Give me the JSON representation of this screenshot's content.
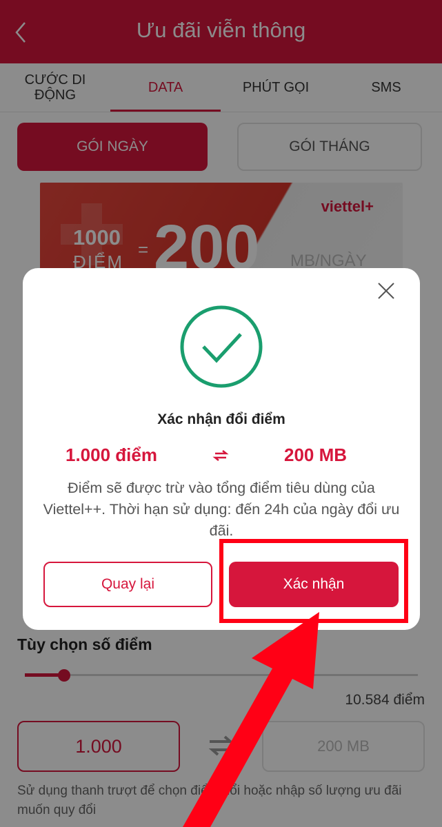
{
  "header": {
    "title": "Ưu đãi viễn thông",
    "back_icon": "chevron-left-icon"
  },
  "tabs": [
    {
      "label": "CƯỚC DI ĐỘNG",
      "active": false
    },
    {
      "label": "DATA",
      "active": true
    },
    {
      "label": "PHÚT GỌI",
      "active": false
    },
    {
      "label": "SMS",
      "active": false
    }
  ],
  "segments": {
    "active": "GÓI NGÀY",
    "inactive": "GÓI THÁNG"
  },
  "banner": {
    "brand": "viettel+",
    "points": "1000",
    "points_unit": "ĐIỂM",
    "equals": "=",
    "amount": "200",
    "amount_unit": "MB/NGÀY"
  },
  "background": {
    "options_label": "Tùy chọn số điểm",
    "slider_level": 0.1,
    "total_points": "10.584 điểm",
    "input_points": "1.000",
    "output_value": "200 MB",
    "hint": "Sử dụng thanh trượt để chọn điểm đổi hoặc nhập số lượng ưu đãi muốn quy đổi"
  },
  "modal": {
    "title": "Xác nhận đổi điểm",
    "from": "1.000 điểm",
    "to": "200 MB",
    "description": "Điểm sẽ được trừ vào tổng điểm tiêu dùng của Viettel++. Thời hạn sử dụng: đến 24h của ngày đổi ưu đãi.",
    "back_label": "Quay lại",
    "confirm_label": "Xác nhận"
  },
  "colors": {
    "brand": "#d6163c",
    "success": "#1a9e6e",
    "annotation": "#ff0015"
  }
}
